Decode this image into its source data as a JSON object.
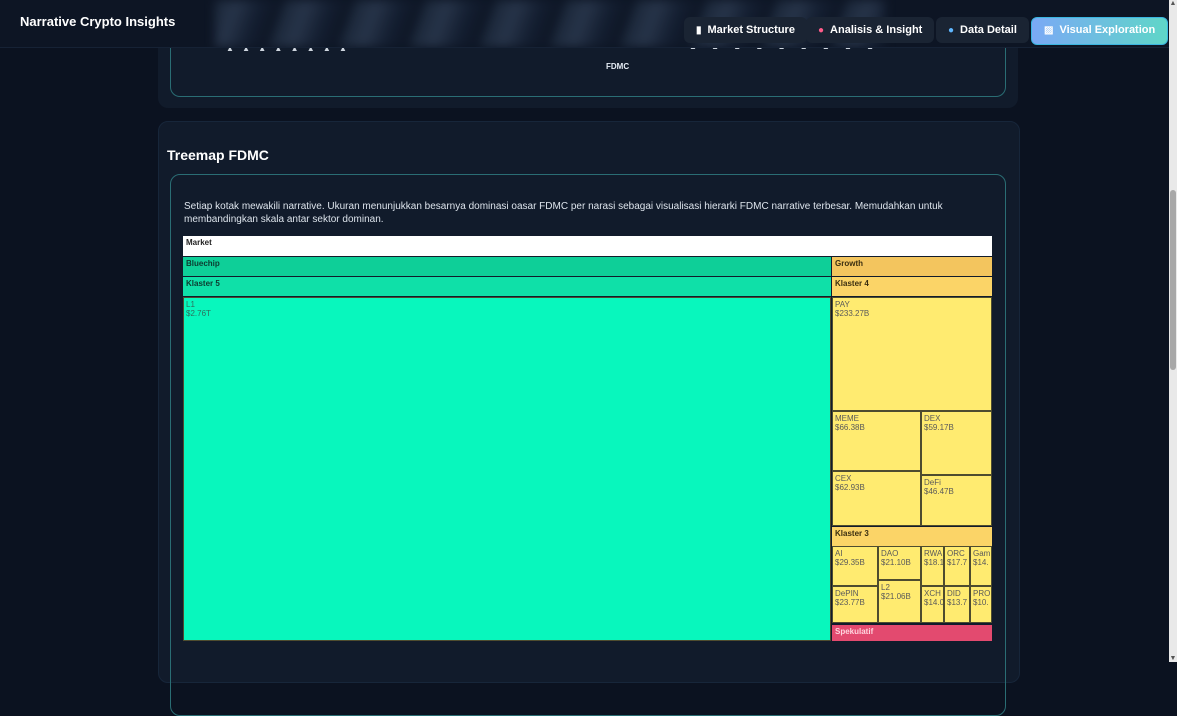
{
  "header": {
    "brand": "Narrative Crypto Insights",
    "nav": [
      {
        "label": "Market Structure",
        "icon": "bar-chart-icon"
      },
      {
        "label": "Analisis & Insight",
        "icon": "pie-icon"
      },
      {
        "label": "Data Detail",
        "icon": "magnifier-icon"
      },
      {
        "label": "Visual Exploration",
        "icon": "chart-icon",
        "active": true
      }
    ]
  },
  "previous_chart": {
    "axis_label": "FDMC",
    "tick_glyphs_left": "▲ ▲  ▲ ▲ ▲ ▲ ▲ ▲",
    "tick_glyphs_right": "▲ ▲ ▲ ▲ ▲ ▲ ▲ ▲ ▲"
  },
  "treemap_section": {
    "title": "Treemap FDMC",
    "description": "Setiap kotak mewakili narrative. Ukuran menunjukkan besarnya dominasi oasar FDMC per narasi sebagai visualisasi hierarki FDMC narrative terbesar. Memudahkan untuk membandingkan skala antar sektor dominan."
  },
  "chart_data": {
    "type": "treemap",
    "root": "Market",
    "groups": [
      {
        "name": "Bluechip",
        "color": "#0bd69c",
        "clusters": [
          {
            "name": "Klaster 5",
            "items": [
              {
                "name": "L1",
                "value_label": "$2.76T",
                "value": 2760
              }
            ]
          }
        ]
      },
      {
        "name": "Growth",
        "color": "#f5c75a",
        "clusters": [
          {
            "name": "Klaster 4",
            "items": [
              {
                "name": "PAY",
                "value_label": "$233.27B",
                "value": 233.27
              },
              {
                "name": "MEME",
                "value_label": "$66.38B",
                "value": 66.38
              },
              {
                "name": "DEX",
                "value_label": "$59.17B",
                "value": 59.17
              },
              {
                "name": "CEX",
                "value_label": "$62.93B",
                "value": 62.93
              },
              {
                "name": "DeFi",
                "value_label": "$46.47B",
                "value": 46.47
              }
            ]
          },
          {
            "name": "Klaster 3",
            "items": [
              {
                "name": "AI",
                "value_label": "$29.35B",
                "value": 29.35
              },
              {
                "name": "DAO",
                "value_label": "$21.10B",
                "value": 21.1
              },
              {
                "name": "RWA",
                "value_label": "$18.1",
                "value": 18.1
              },
              {
                "name": "ORC",
                "value_label": "$17.7",
                "value": 17.7
              },
              {
                "name": "Gam",
                "value_label": "$14.",
                "value": 14
              },
              {
                "name": "DePIN",
                "value_label": "$23.77B",
                "value": 23.77
              },
              {
                "name": "L2",
                "value_label": "$21.06B",
                "value": 21.06
              },
              {
                "name": "XCH",
                "value_label": "$14.0",
                "value": 14.0
              },
              {
                "name": "DID",
                "value_label": "$13.7",
                "value": 13.7
              },
              {
                "name": "PRO",
                "value_label": "$10.",
                "value": 10
              }
            ]
          }
        ]
      },
      {
        "name": "Spekulatif",
        "color": "#e34a6f",
        "clusters": []
      }
    ]
  }
}
